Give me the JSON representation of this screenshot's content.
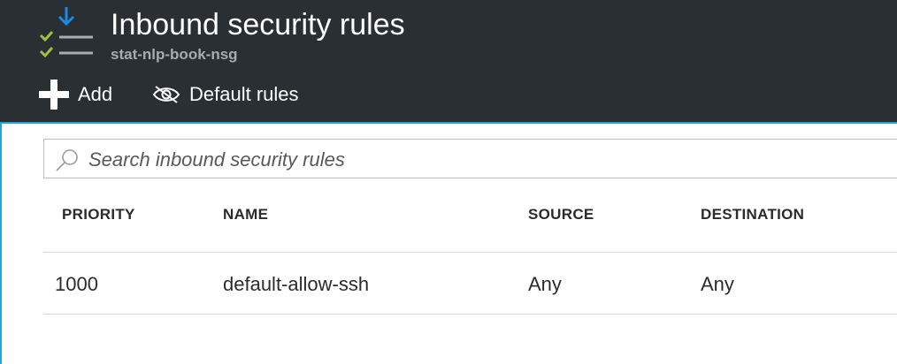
{
  "header": {
    "title": "Inbound security rules",
    "subtitle": "stat-nlp-book-nsg",
    "icon": "security-rules-icon"
  },
  "toolbar": {
    "add_label": "Add",
    "default_rules_label": "Default rules"
  },
  "search": {
    "placeholder": "Search inbound security rules",
    "value": ""
  },
  "table": {
    "columns": [
      "PRIORITY",
      "NAME",
      "SOURCE",
      "DESTINATION"
    ],
    "rows": [
      {
        "priority": "1000",
        "name": "default-allow-ssh",
        "source": "Any",
        "destination": "Any"
      }
    ]
  },
  "colors": {
    "header_bg": "#2a2f34",
    "accent": "#23a3dc",
    "check_green": "#9ec33b",
    "arrow_blue": "#1e88e5"
  }
}
